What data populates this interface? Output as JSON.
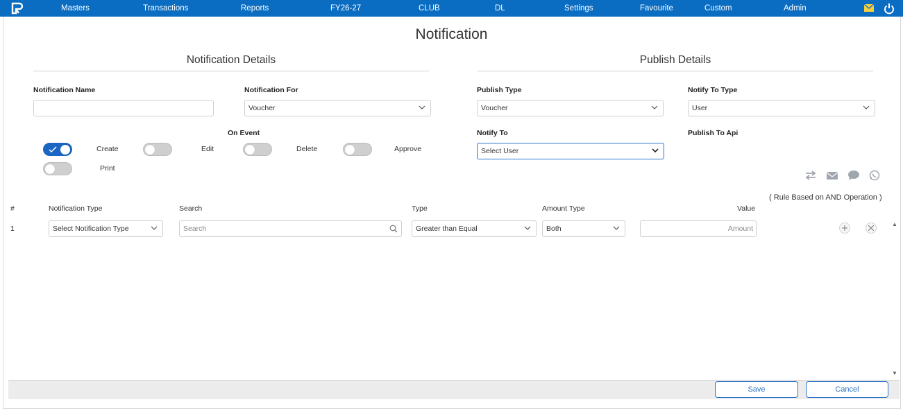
{
  "nav": {
    "items": [
      "Masters",
      "Transactions",
      "Reports",
      "FY26-27",
      "CLUB",
      "DL",
      "Settings",
      "Favourite",
      "Custom",
      "Admin"
    ],
    "icons": [
      "mail-icon",
      "power-icon"
    ],
    "accent": "#0a6dc2"
  },
  "page": {
    "title": "Notification",
    "notification_details": "Notification Details",
    "publish_details": "Publish Details"
  },
  "form": {
    "notification_name_label": "Notification Name",
    "notification_name_value": "",
    "notification_for_label": "Notification For",
    "notification_for_value": "Voucher",
    "publish_type_label": "Publish Type",
    "publish_type_value": "Voucher",
    "notify_to_type_label": "Notify To Type",
    "notify_to_type_value": "User",
    "on_event_label": "On Event",
    "notify_to_label": "Notify To",
    "notify_to_value": "Select User",
    "publish_to_api_label": "Publish To Api"
  },
  "events": {
    "create": {
      "label": "Create",
      "on": true
    },
    "edit": {
      "label": "Edit",
      "on": false
    },
    "delete": {
      "label": "Delete",
      "on": false
    },
    "approve": {
      "label": "Approve",
      "on": false
    },
    "print": {
      "label": "Print",
      "on": false
    }
  },
  "channels": [
    "transfer-icon",
    "email-icon",
    "chat-icon",
    "whatsapp-icon"
  ],
  "rule_note": "( Rule Based on AND Operation )",
  "table": {
    "headers": {
      "num": "#",
      "notification_type": "Notification Type",
      "search": "Search",
      "type": "Type",
      "amount_type": "Amount Type",
      "value": "Value"
    },
    "rows": [
      {
        "num": "1",
        "notification_type": "Select Notification Type",
        "search_placeholder": "Search",
        "type": "Greater than Equal",
        "amount_type": "Both",
        "amount_placeholder": "Amount"
      }
    ]
  },
  "footer": {
    "save": "Save",
    "cancel": "Cancel"
  }
}
